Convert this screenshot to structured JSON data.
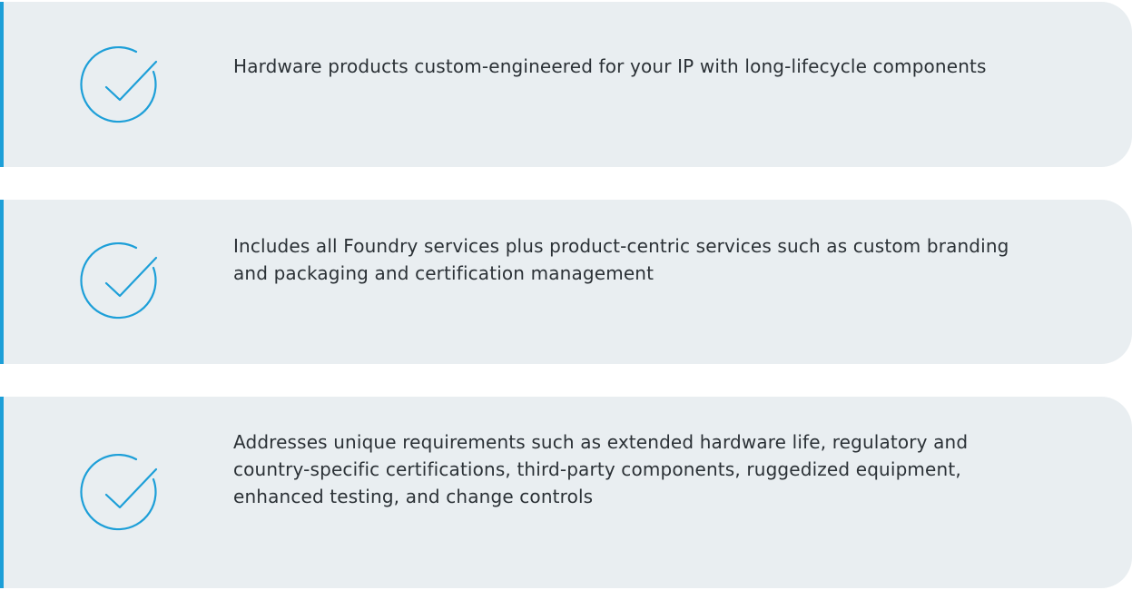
{
  "colors": {
    "accent": "#1d9fd8",
    "card_background": "#e9eef1",
    "text": "#2b3136"
  },
  "features": [
    {
      "icon": "checkmark-circle-icon",
      "text": "Hardware products custom-engineered for your IP with long-lifecycle components"
    },
    {
      "icon": "checkmark-circle-icon",
      "text": "Includes all Foundry services plus product-centric services such as custom branding and packaging and certification management"
    },
    {
      "icon": "checkmark-circle-icon",
      "text": "Addresses unique requirements such as extended hardware life, regulatory and country-specific certifications, third-party components, ruggedized equipment, enhanced testing, and change controls"
    }
  ]
}
